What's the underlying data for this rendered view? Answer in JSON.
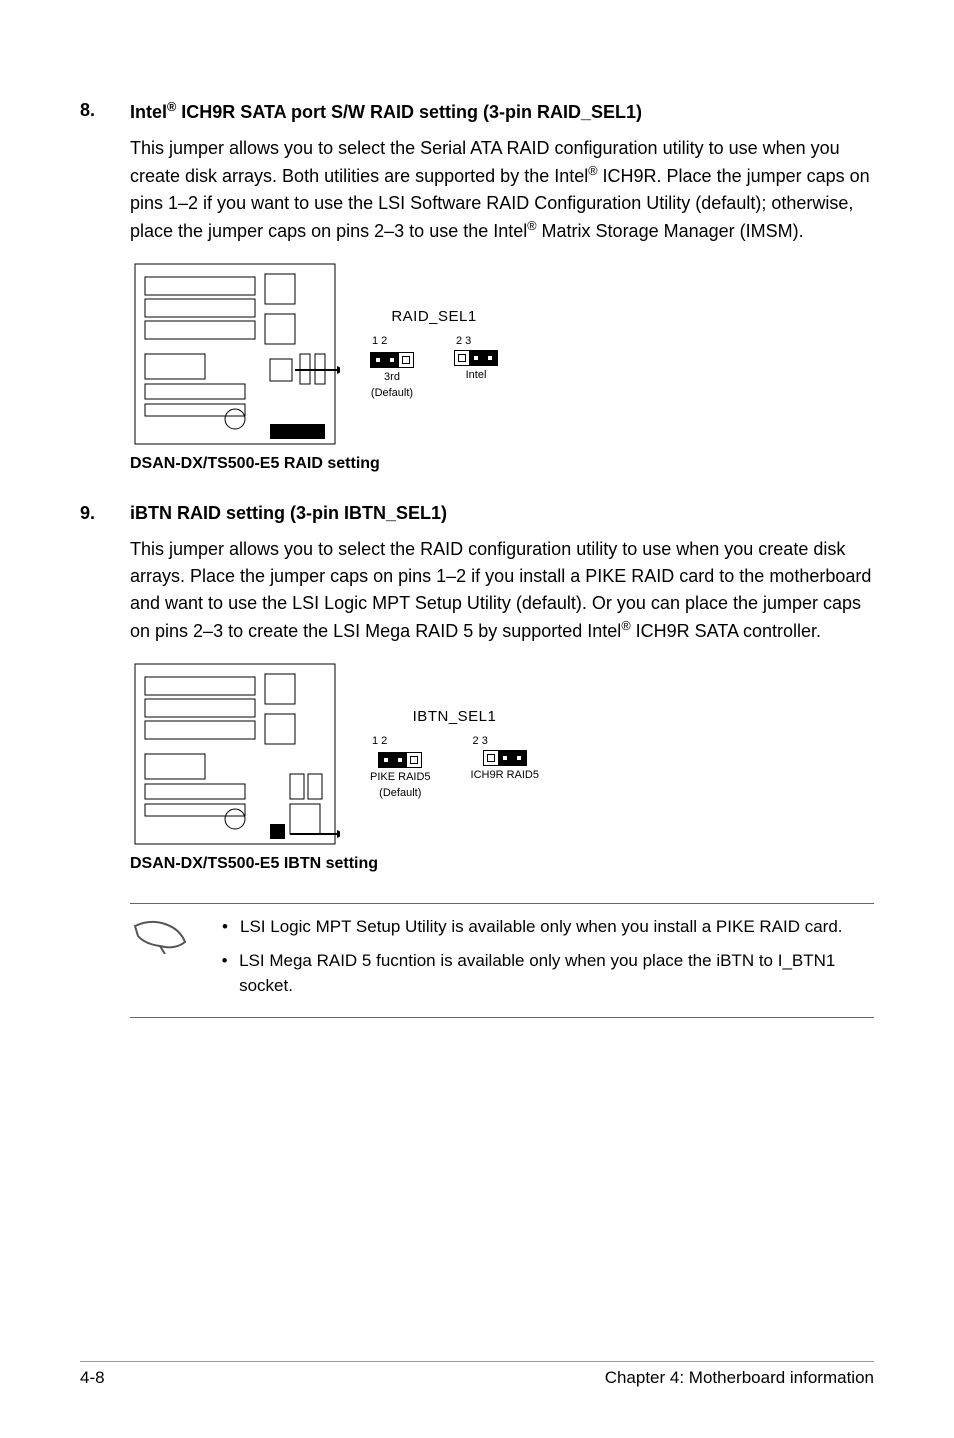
{
  "sections": [
    {
      "num": "8.",
      "title_pre": "Intel",
      "title_sup": "®",
      "title_post": " ICH9R SATA port S/W RAID setting (3-pin RAID_SEL1)",
      "body_1": "This jumper allows you to select the Serial ATA RAID configuration utility to use when you create disk arrays. Both utilities are supported by the Intel",
      "body_sup1": "®",
      "body_2": " ICH9R. Place the jumper caps on pins 1–2 if you want to use the LSI Software RAID Configuration Utility (default); otherwise, place the jumper caps on pins 2–3 to use the Intel",
      "body_sup2": "®",
      "body_3": " Matrix Storage Manager (IMSM).",
      "jumper_label": "RAID_SEL1",
      "left_pins": "1   2",
      "right_pins": "2   3",
      "left_caption_1": "3rd",
      "left_caption_2": "(Default)",
      "right_caption_1": "Intel",
      "right_caption_2": "",
      "caption": "DSAN-DX/TS500-E5 RAID setting"
    },
    {
      "num": "9.",
      "title_pre": "iBTN RAID setting (3-pin IBTN_SEL1)",
      "title_sup": "",
      "title_post": "",
      "body_1": "This jumper allows you to select the RAID configuration utility to use when you create disk arrays. Place the jumper caps on pins 1–2 if you install a PIKE RAID card to the motherboard and want to use the LSI Logic MPT Setup Utility (default). Or you can place the jumper caps on pins 2–3 to create the LSI Mega RAID 5 by supported Intel",
      "body_sup1": "®",
      "body_2": " ICH9R SATA controller.",
      "body_sup2": "",
      "body_3": "",
      "jumper_label": "IBTN_SEL1",
      "left_pins": "1   2",
      "right_pins": "2   3",
      "left_caption_1": "PIKE RAID5",
      "left_caption_2": "(Default)",
      "right_caption_1": "ICH9R RAID5",
      "right_caption_2": "",
      "caption": "DSAN-DX/TS500-E5 IBTN setting"
    }
  ],
  "notes": [
    "LSI Logic MPT Setup Utility is available only when you install a PIKE RAID card.",
    "LSI Mega RAID 5 fucntion is available only when you place the iBTN to I_BTN1 socket."
  ],
  "footer_left": "4-8",
  "footer_right": "Chapter 4: Motherboard information"
}
